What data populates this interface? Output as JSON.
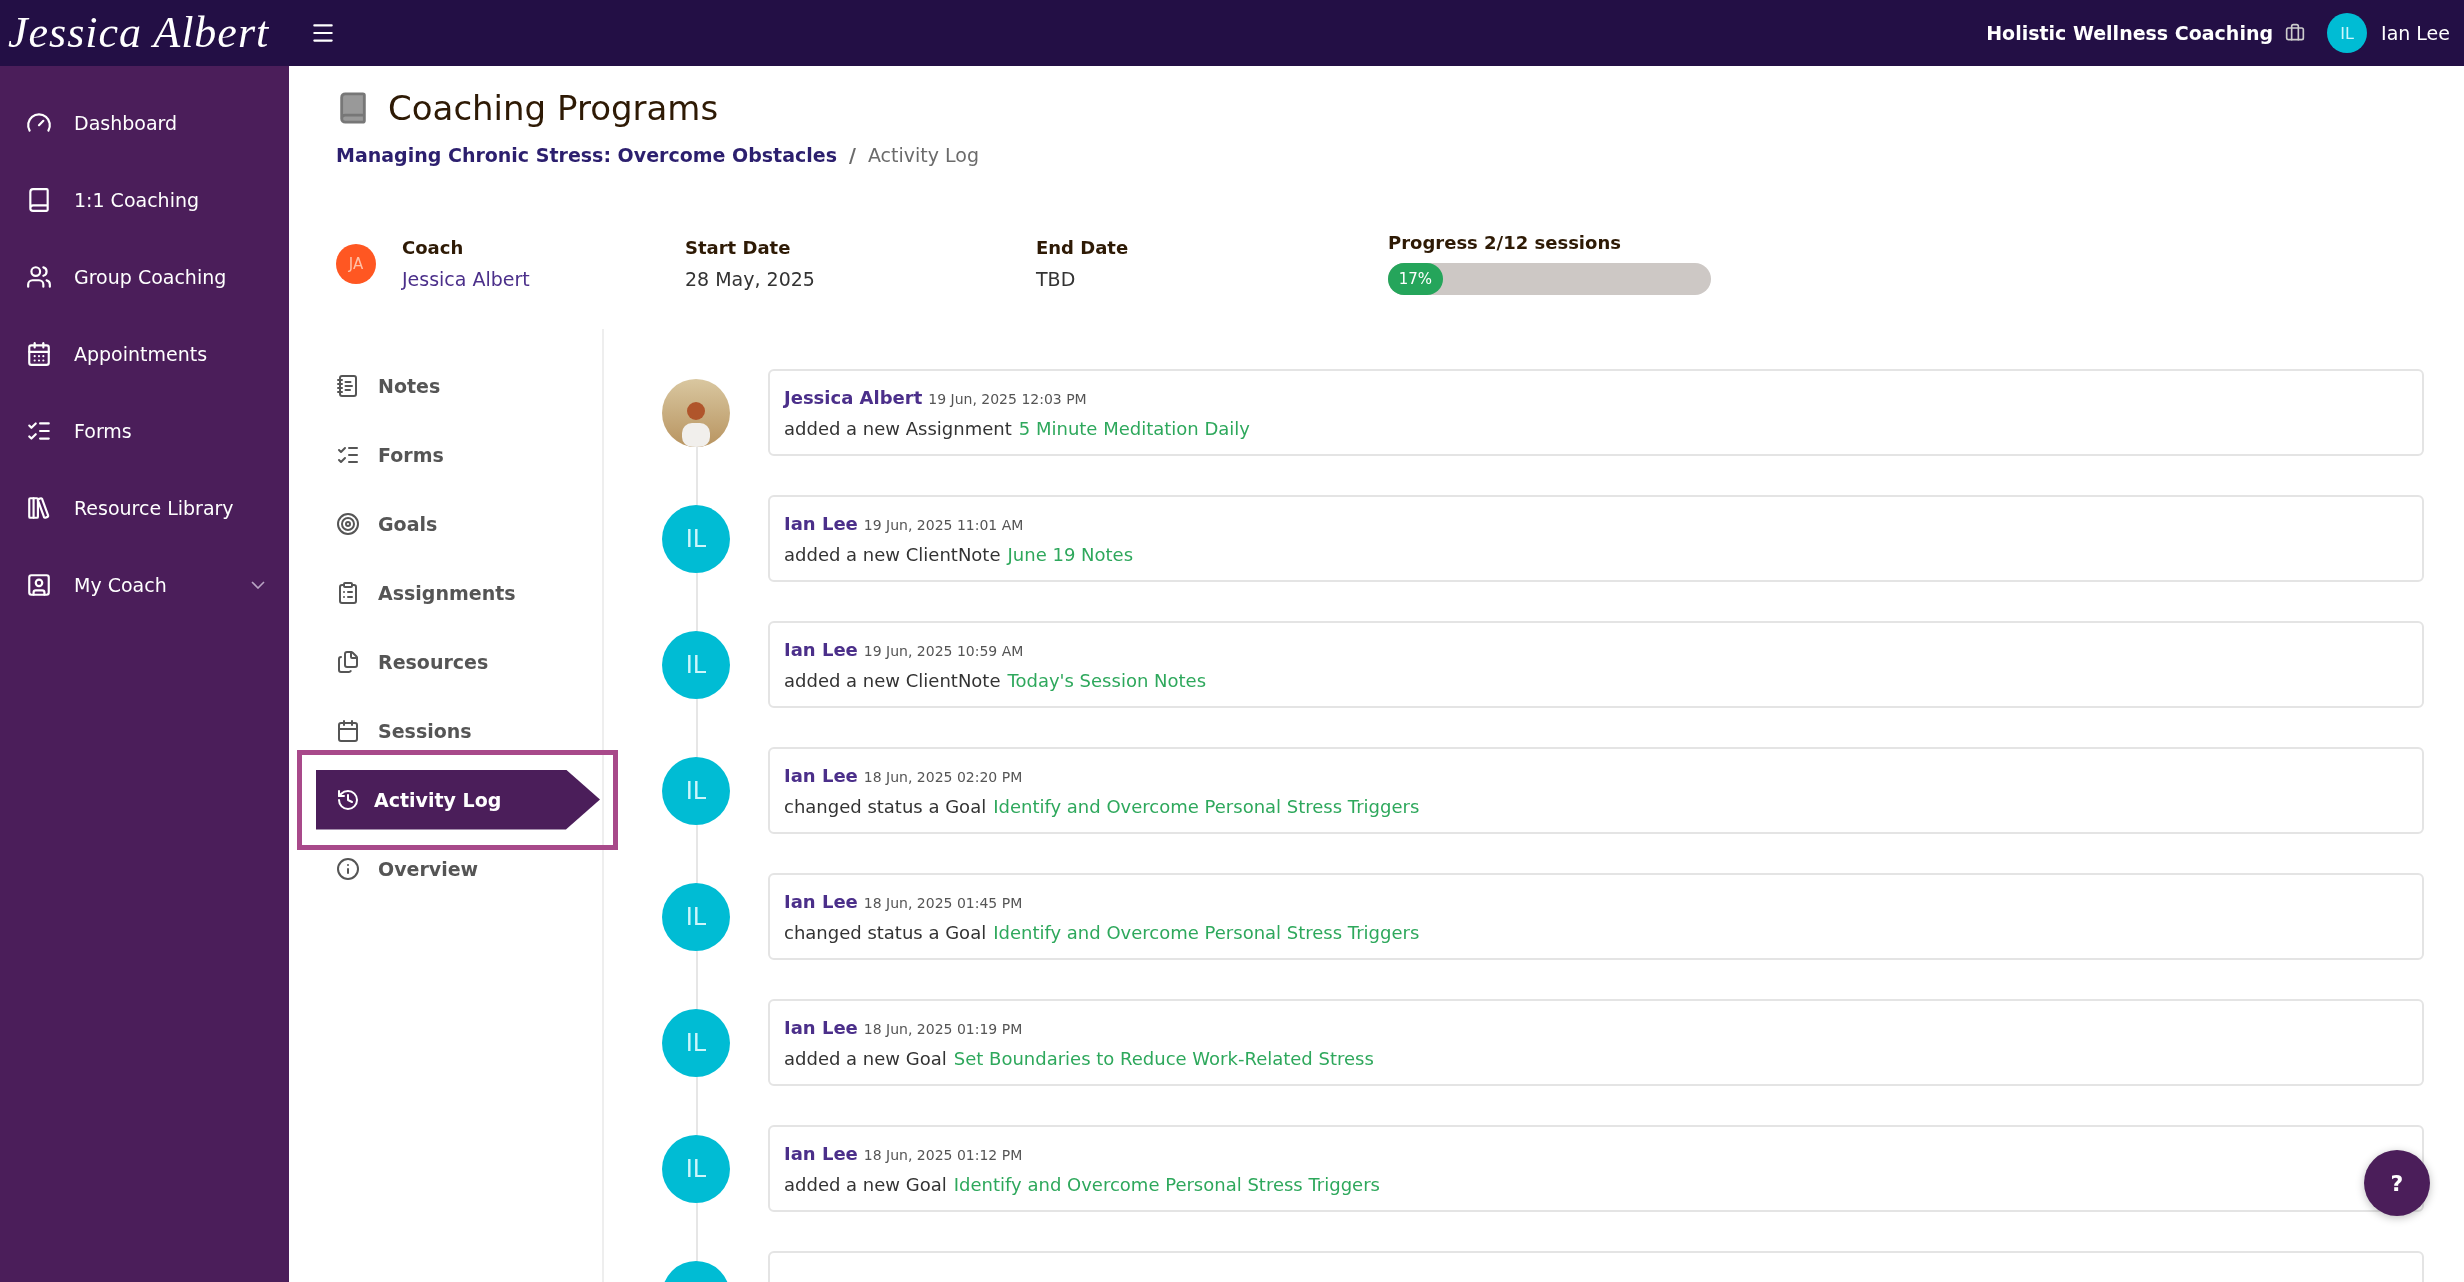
{
  "header": {
    "logo": "Jessica Albert",
    "organization": "Holistic Wellness Coaching",
    "user": {
      "initials": "IL",
      "name": "Ian Lee"
    }
  },
  "sidebar": {
    "items": [
      {
        "label": "Dashboard",
        "kind": "link"
      },
      {
        "label": "1:1 Coaching",
        "kind": "link"
      },
      {
        "label": "Group Coaching",
        "kind": "link"
      },
      {
        "label": "Appointments",
        "kind": "link"
      },
      {
        "label": "Forms",
        "kind": "link"
      },
      {
        "label": "Resource Library",
        "kind": "link"
      },
      {
        "label": "My Coach",
        "kind": "group"
      }
    ]
  },
  "page": {
    "title": "Coaching Programs",
    "breadcrumb": [
      {
        "label": "Managing Chronic Stress: Overcome Obstacles",
        "kind": "link"
      },
      {
        "label": "/",
        "kind": "separator"
      },
      {
        "label": "Activity Log",
        "kind": "current"
      }
    ]
  },
  "program": {
    "coach": {
      "initials": "JA",
      "label": "Coach",
      "name": "Jessica Albert"
    },
    "start": {
      "label": "Start Date",
      "value": "28 May, 2025"
    },
    "end": {
      "label": "End Date",
      "value": "TBD"
    },
    "progress": {
      "label": "Progress 2/12 sessions",
      "level": 0.17,
      "reading": "17%"
    }
  },
  "tabs": [
    {
      "label": "Notes",
      "selected": false
    },
    {
      "label": "Forms",
      "selected": false
    },
    {
      "label": "Goals",
      "selected": false
    },
    {
      "label": "Assignments",
      "selected": false
    },
    {
      "label": "Resources",
      "selected": false
    },
    {
      "label": "Sessions",
      "selected": false
    },
    {
      "label": "Activity Log",
      "selected": true
    },
    {
      "label": "Overview",
      "selected": false
    }
  ],
  "activity": [
    {
      "avatar": {
        "kind": "photo"
      },
      "user": "Jessica Albert",
      "time": "19 Jun, 2025 12:03 PM",
      "action": "added a new Assignment",
      "target": "5 Minute Meditation Daily"
    },
    {
      "avatar": {
        "kind": "initials",
        "initials": "IL"
      },
      "user": "Ian Lee",
      "time": "19 Jun, 2025 11:01 AM",
      "action": "added a new ClientNote",
      "target": "June 19 Notes"
    },
    {
      "avatar": {
        "kind": "initials",
        "initials": "IL"
      },
      "user": "Ian Lee",
      "time": "19 Jun, 2025 10:59 AM",
      "action": "added a new ClientNote",
      "target": "Today's Session Notes"
    },
    {
      "avatar": {
        "kind": "initials",
        "initials": "IL"
      },
      "user": "Ian Lee",
      "time": "18 Jun, 2025 02:20 PM",
      "action": "changed status a Goal",
      "target": "Identify and Overcome Personal Stress Triggers"
    },
    {
      "avatar": {
        "kind": "initials",
        "initials": "IL"
      },
      "user": "Ian Lee",
      "time": "18 Jun, 2025 01:45 PM",
      "action": "changed status a Goal",
      "target": "Identify and Overcome Personal Stress Triggers"
    },
    {
      "avatar": {
        "kind": "initials",
        "initials": "IL"
      },
      "user": "Ian Lee",
      "time": "18 Jun, 2025 01:19 PM",
      "action": "added a new Goal",
      "target": "Set Boundaries to Reduce Work-Related Stress"
    },
    {
      "avatar": {
        "kind": "initials",
        "initials": "IL"
      },
      "user": "Ian Lee",
      "time": "18 Jun, 2025 01:12 PM",
      "action": "added a new Goal",
      "target": "Identify and Overcome Personal Stress Triggers"
    },
    {
      "avatar": {
        "kind": "initials"
      }
    }
  ],
  "help": {
    "label": "?"
  }
}
